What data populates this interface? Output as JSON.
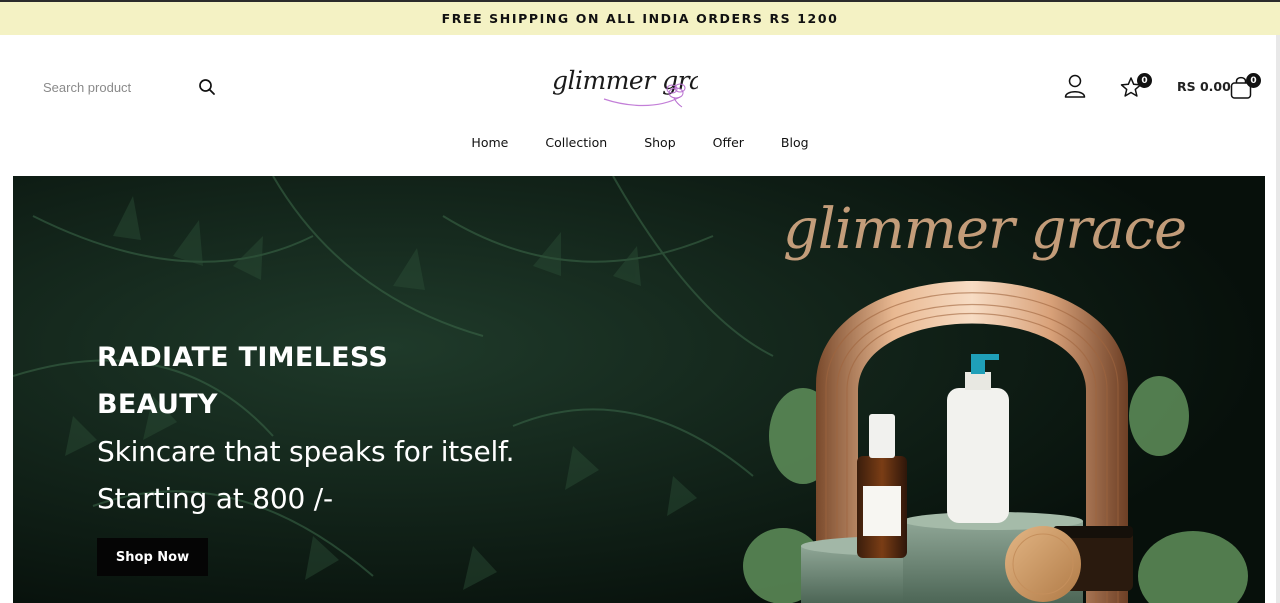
{
  "announcement": {
    "text": "FREE SHIPPING ON ALL INDIA ORDERS RS 1200"
  },
  "header": {
    "search": {
      "placeholder": "Search product"
    },
    "logo_text": "glimmer grace",
    "wishlist_count": "0",
    "cart_total": "RS 0.00",
    "cart_count": "0"
  },
  "nav": {
    "items": [
      {
        "label": "Home"
      },
      {
        "label": "Collection"
      },
      {
        "label": "Shop"
      },
      {
        "label": "Offer"
      },
      {
        "label": "Blog"
      }
    ]
  },
  "hero": {
    "watermark": "glimmer grace",
    "line1": "RADIATE TIMELESS",
    "line2": "BEAUTY",
    "line3": "Skincare that speaks for itself.",
    "line4": "Starting at 800 /-",
    "cta_label": "Shop Now"
  },
  "colors": {
    "announcement_bg": "#f4f2c4",
    "hero_bg": "#0f1a14",
    "cta_bg": "#050505",
    "badge_bg": "#111111"
  }
}
